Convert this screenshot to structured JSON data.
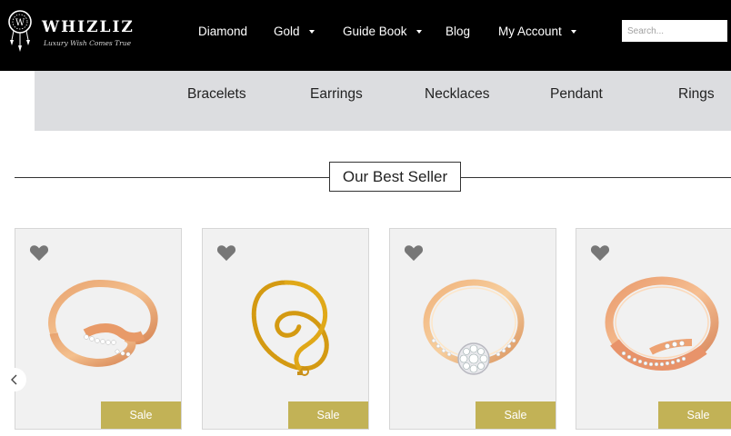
{
  "brand": {
    "name": "WHIZLIZ",
    "tagline": "Luxury Wish Comes True"
  },
  "nav": {
    "items": [
      {
        "label": "Diamond",
        "has_dropdown": false
      },
      {
        "label": "Gold",
        "has_dropdown": true
      },
      {
        "label": "Guide Book",
        "has_dropdown": true
      },
      {
        "label": "Blog",
        "has_dropdown": false
      },
      {
        "label": "My Account",
        "has_dropdown": true
      }
    ]
  },
  "search": {
    "placeholder": "Search..."
  },
  "categories": [
    "Bracelets",
    "Earrings",
    "Necklaces",
    "Pendant",
    "Rings"
  ],
  "section": {
    "title": "Our Best Seller"
  },
  "products": [
    {
      "image": "rose-gold-twist-ring",
      "badge": "Sale"
    },
    {
      "image": "gold-ball-chain-necklace",
      "badge": "Sale"
    },
    {
      "image": "gold-solitaire-cluster-ring",
      "badge": "Sale"
    },
    {
      "image": "rose-gold-diamond-band-ring",
      "badge": "Sale"
    }
  ],
  "colors": {
    "header_bg": "#000000",
    "category_bar_bg": "#dcdde0",
    "sale_badge": "#c2b256",
    "card_bg": "#f1f1f1",
    "heart_icon": "#777777"
  }
}
